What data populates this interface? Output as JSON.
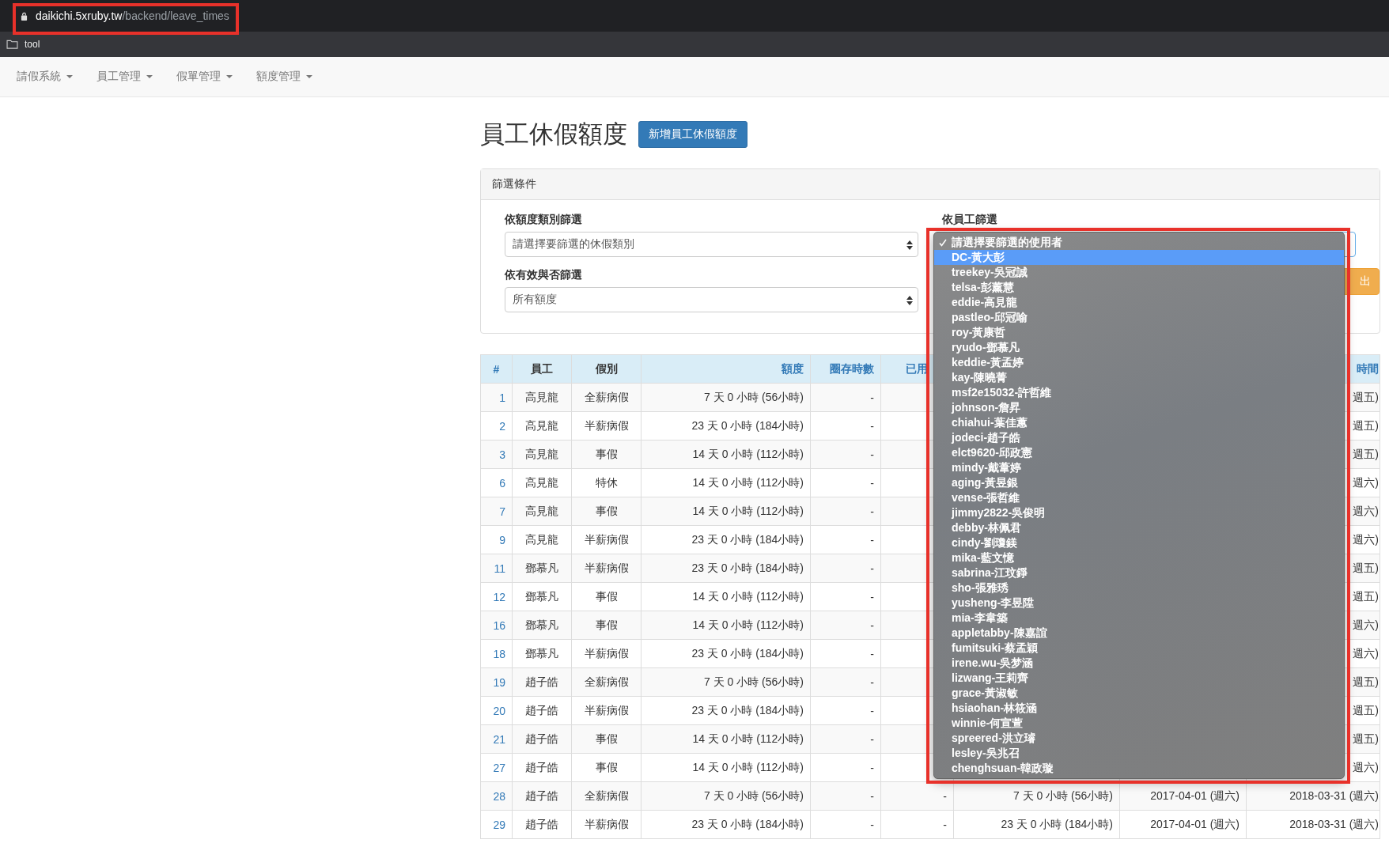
{
  "browser": {
    "url_host": "daikichi.5xruby.tw",
    "url_path": "/backend/leave_times",
    "bookmark": "tool"
  },
  "navbar": {
    "menus": [
      "請假系統",
      "員工管理",
      "假單管理",
      "額度管理"
    ]
  },
  "page": {
    "title": "員工休假額度",
    "new_button": "新增員工休假額度"
  },
  "filter_panel": {
    "heading": "篩選條件",
    "category_label": "依額度類別篩選",
    "category_value": "請選擇要篩選的休假類別",
    "validity_label": "依有效與否篩選",
    "validity_value": "所有額度",
    "employee_label": "依員工篩選",
    "export_button": "出"
  },
  "table": {
    "columns": [
      {
        "label": "#",
        "link": true
      },
      {
        "label": "員工",
        "link": false
      },
      {
        "label": "假別",
        "link": false
      },
      {
        "label": "額度",
        "link": true
      },
      {
        "label": "圈存時數",
        "link": true
      },
      {
        "label": "已用",
        "link": true
      },
      {
        "label": "時間",
        "link": true
      }
    ],
    "rows": [
      {
        "id": "1",
        "employee": "高見龍",
        "type": "全薪病假",
        "quota": "7 天 0 小時 (56小時)",
        "reserved": "-",
        "end": "週五)"
      },
      {
        "id": "2",
        "employee": "高見龍",
        "type": "半薪病假",
        "quota": "23 天 0 小時 (184小時)",
        "reserved": "-",
        "end": "週五)"
      },
      {
        "id": "3",
        "employee": "高見龍",
        "type": "事假",
        "quota": "14 天 0 小時 (112小時)",
        "reserved": "-",
        "end": "週五)"
      },
      {
        "id": "6",
        "employee": "高見龍",
        "type": "特休",
        "quota": "14 天 0 小時 (112小時)",
        "reserved": "-",
        "end": "週六)"
      },
      {
        "id": "7",
        "employee": "高見龍",
        "type": "事假",
        "quota": "14 天 0 小時 (112小時)",
        "reserved": "-",
        "end": "週六)"
      },
      {
        "id": "9",
        "employee": "高見龍",
        "type": "半薪病假",
        "quota": "23 天 0 小時 (184小時)",
        "reserved": "-",
        "end": "週六)"
      },
      {
        "id": "11",
        "employee": "鄧慕凡",
        "type": "半薪病假",
        "quota": "23 天 0 小時 (184小時)",
        "reserved": "-",
        "end": "週五)"
      },
      {
        "id": "12",
        "employee": "鄧慕凡",
        "type": "事假",
        "quota": "14 天 0 小時 (112小時)",
        "reserved": "-",
        "end": "週五)"
      },
      {
        "id": "16",
        "employee": "鄧慕凡",
        "type": "事假",
        "quota": "14 天 0 小時 (112小時)",
        "reserved": "-",
        "end": "週六)"
      },
      {
        "id": "18",
        "employee": "鄧慕凡",
        "type": "半薪病假",
        "quota": "23 天 0 小時 (184小時)",
        "reserved": "-",
        "end": "週六)"
      },
      {
        "id": "19",
        "employee": "趙子皓",
        "type": "全薪病假",
        "quota": "7 天 0 小時 (56小時)",
        "reserved": "-",
        "end": "週五)"
      },
      {
        "id": "20",
        "employee": "趙子皓",
        "type": "半薪病假",
        "quota": "23 天 0 小時 (184小時)",
        "reserved": "-",
        "end": "週五)"
      },
      {
        "id": "21",
        "employee": "趙子皓",
        "type": "事假",
        "quota": "14 天 0 小時 (112小時)",
        "reserved": "-",
        "end": "週五)"
      },
      {
        "id": "27",
        "employee": "趙子皓",
        "type": "事假",
        "quota": "14 天 0 小時 (112小時)",
        "reserved": "-",
        "end": "週六)"
      },
      {
        "id": "28",
        "employee": "趙子皓",
        "type": "全薪病假",
        "quota": "7 天 0 小時 (56小時)",
        "reserved": "-",
        "used": "-",
        "remaining": "7 天 0 小時 (56小時)",
        "start": "2017-04-01 (週六)",
        "end": "2018-03-31 (週六)"
      },
      {
        "id": "29",
        "employee": "趙子皓",
        "type": "半薪病假",
        "quota": "23 天 0 小時 (184小時)",
        "reserved": "-",
        "used": "-",
        "remaining": "23 天 0 小時 (184小時)",
        "start": "2017-04-01 (週六)",
        "end": "2018-03-31 (週六)"
      }
    ]
  },
  "employee_dropdown": {
    "items": [
      {
        "label": "請選擇要篩選的使用者",
        "checked": true,
        "selected": false
      },
      {
        "label": "DC-黃大彭",
        "checked": false,
        "selected": true
      },
      {
        "label": "treekey-吳冠誠",
        "checked": false,
        "selected": false
      },
      {
        "label": "telsa-彭薰慧",
        "checked": false,
        "selected": false
      },
      {
        "label": "eddie-高見龍",
        "checked": false,
        "selected": false
      },
      {
        "label": "pastleo-邱冠喻",
        "checked": false,
        "selected": false
      },
      {
        "label": "roy-黃康哲",
        "checked": false,
        "selected": false
      },
      {
        "label": "ryudo-鄧慕凡",
        "checked": false,
        "selected": false
      },
      {
        "label": "keddie-黃孟婷",
        "checked": false,
        "selected": false
      },
      {
        "label": "kay-陳曉菁",
        "checked": false,
        "selected": false
      },
      {
        "label": "msf2e15032-許哲維",
        "checked": false,
        "selected": false
      },
      {
        "label": "johnson-詹昇",
        "checked": false,
        "selected": false
      },
      {
        "label": "chiahui-葉佳蕙",
        "checked": false,
        "selected": false
      },
      {
        "label": "jodeci-趙子皓",
        "checked": false,
        "selected": false
      },
      {
        "label": "elct9620-邱政憲",
        "checked": false,
        "selected": false
      },
      {
        "label": "mindy-戴葦婷",
        "checked": false,
        "selected": false
      },
      {
        "label": "aging-黃昱銀",
        "checked": false,
        "selected": false
      },
      {
        "label": "vense-張哲維",
        "checked": false,
        "selected": false
      },
      {
        "label": "jimmy2822-吳俊明",
        "checked": false,
        "selected": false
      },
      {
        "label": "debby-林佩君",
        "checked": false,
        "selected": false
      },
      {
        "label": "cindy-劉瓊鎂",
        "checked": false,
        "selected": false
      },
      {
        "label": "mika-藍文憶",
        "checked": false,
        "selected": false
      },
      {
        "label": "sabrina-江玟錚",
        "checked": false,
        "selected": false
      },
      {
        "label": "sho-張雅琇",
        "checked": false,
        "selected": false
      },
      {
        "label": "yusheng-李昱陞",
        "checked": false,
        "selected": false
      },
      {
        "label": "mia-李韋築",
        "checked": false,
        "selected": false
      },
      {
        "label": "appletabby-陳嘉誼",
        "checked": false,
        "selected": false
      },
      {
        "label": "fumitsuki-蔡孟穎",
        "checked": false,
        "selected": false
      },
      {
        "label": "irene.wu-吳梦涵",
        "checked": false,
        "selected": false
      },
      {
        "label": "lizwang-王莉齊",
        "checked": false,
        "selected": false
      },
      {
        "label": "grace-黃淑敏",
        "checked": false,
        "selected": false
      },
      {
        "label": "hsiaohan-林筱涵",
        "checked": false,
        "selected": false
      },
      {
        "label": "winnie-何宣萱",
        "checked": false,
        "selected": false
      },
      {
        "label": "spreered-洪立璿",
        "checked": false,
        "selected": false
      },
      {
        "label": "lesley-吳兆召",
        "checked": false,
        "selected": false
      },
      {
        "label": "chenghsuan-韓政璇",
        "checked": false,
        "selected": false
      }
    ]
  }
}
